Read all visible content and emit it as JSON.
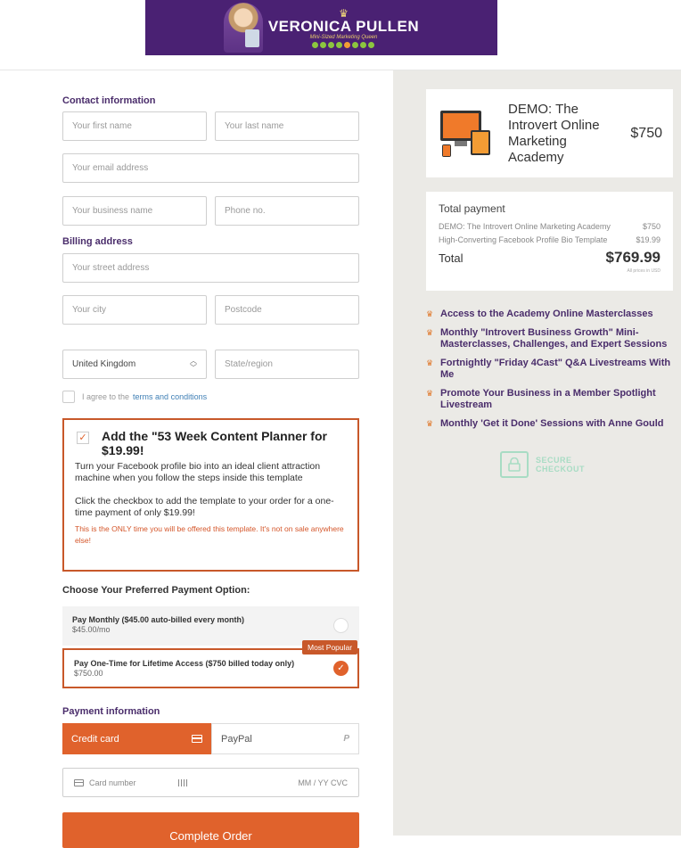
{
  "banner": {
    "name": "VERONICA PULLEN",
    "tagline": "Mini-Sized Marketing Queen"
  },
  "contact": {
    "label": "Contact information",
    "first_name_placeholder": "Your first name",
    "last_name_placeholder": "Your last name",
    "email_placeholder": "Your email address",
    "business_placeholder": "Your business name",
    "phone_placeholder": "Phone no."
  },
  "billing": {
    "label": "Billing address",
    "street_placeholder": "Your street address",
    "city_placeholder": "Your city",
    "postcode_placeholder": "Postcode",
    "country_value": "United Kingdom",
    "state_placeholder": "State/region"
  },
  "terms": {
    "prefix": "I agree to the",
    "link": "terms and conditions"
  },
  "offer": {
    "title": "Add the \"53 Week Content Planner for $19.99!",
    "description": "Turn your Facebook profile bio into an ideal client attraction machine when you follow the steps inside this template",
    "instruction": "Click the checkbox to add the template to your order for a one-time payment of only $19.99!",
    "warning": "This is the ONLY time you will be offered this template. It's not on sale anywhere else!",
    "checked": true
  },
  "payment_options": {
    "label": "Choose Your Preferred Payment Option:",
    "monthly_title": "Pay Monthly ($45.00 auto-billed every month)",
    "monthly_sub": "$45.00/mo",
    "onetime_title": "Pay One-Time for Lifetime Access ($750 billed today only)",
    "onetime_sub": "$750.00",
    "badge": "Most Popular",
    "selected": "onetime"
  },
  "payment": {
    "label": "Payment information",
    "credit_card_tab": "Credit card",
    "paypal_tab": "PayPal",
    "paypal_icon": "P",
    "card_number_placeholder": "Card number",
    "expiry_cvc": "MM / YY  CVC",
    "submit": "Complete Order"
  },
  "product": {
    "title": "DEMO: The Introvert Online Marketing Academy",
    "price": "$750"
  },
  "summary": {
    "heading": "Total payment",
    "items": [
      {
        "name": "DEMO: The Introvert Online Marketing Academy",
        "price": "$750"
      },
      {
        "name": "High-Converting Facebook Profile Bio Template",
        "price": "$19.99"
      }
    ],
    "total_label": "Total",
    "total_value": "$769.99",
    "note": "All prices in USD"
  },
  "benefits": [
    "Access to the Academy Online Masterclasses",
    "Monthly \"Introvert Business Growth\" Mini-Masterclasses, Challenges, and Expert Sessions",
    "Fortnightly \"Friday 4Cast\" Q&A Livestreams With Me",
    "Promote Your Business in a Member Spotlight Livestream",
    "Monthly 'Get it Done' Sessions with Anne Gould"
  ],
  "secure": {
    "line1": "SECURE",
    "line2": "CHECKOUT"
  },
  "colors": {
    "accent": "#e0622c",
    "brand_purple": "#4a2173",
    "panel_bg": "#ebeae6"
  }
}
